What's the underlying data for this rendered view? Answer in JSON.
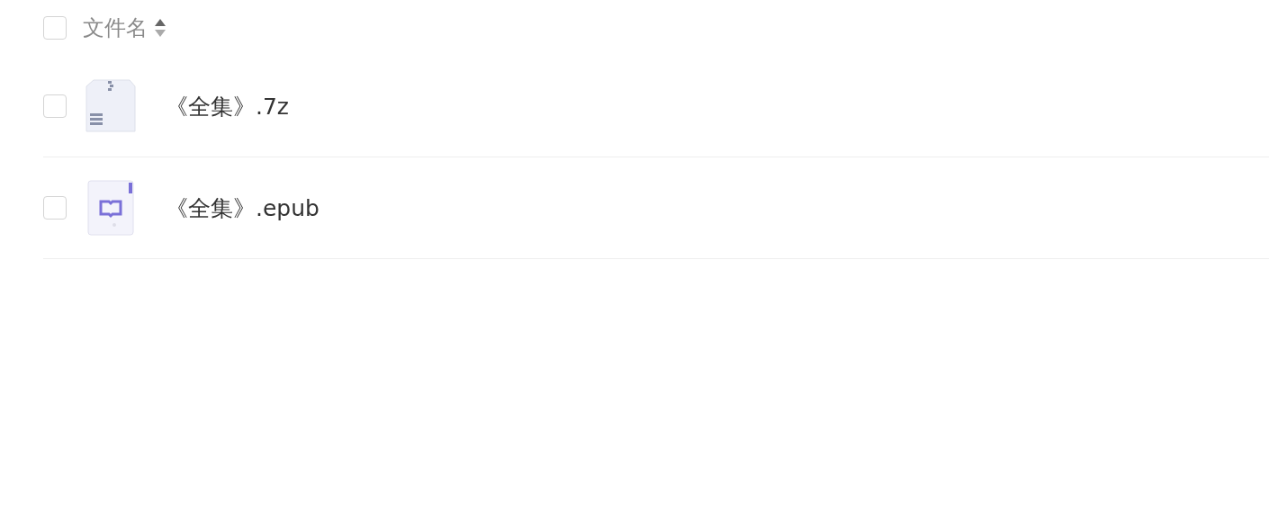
{
  "header": {
    "checked": false,
    "label": "文件名"
  },
  "files": [
    {
      "kind": "archive",
      "name": "《全集》.7z",
      "checked": false
    },
    {
      "kind": "ebook",
      "name": "《全集》.epub",
      "checked": false
    }
  ]
}
